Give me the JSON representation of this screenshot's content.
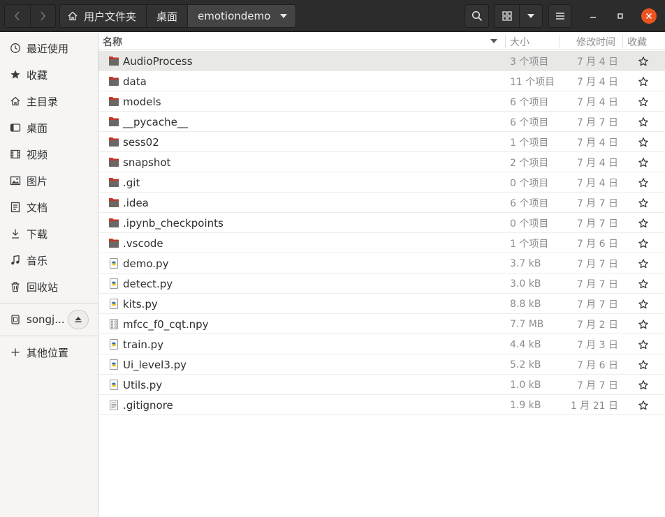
{
  "breadcrumb": {
    "home_label": "用户文件夹",
    "items": [
      "桌面",
      "emotiondemo"
    ]
  },
  "sidebar": {
    "items": [
      {
        "label": "最近使用",
        "icon": "clock-icon"
      },
      {
        "label": "收藏",
        "icon": "star-icon"
      },
      {
        "label": "主目录",
        "icon": "home-icon"
      },
      {
        "label": "桌面",
        "icon": "desktop-icon"
      },
      {
        "label": "视频",
        "icon": "video-icon"
      },
      {
        "label": "图片",
        "icon": "image-icon"
      },
      {
        "label": "文档",
        "icon": "document-icon"
      },
      {
        "label": "下载",
        "icon": "download-icon"
      },
      {
        "label": "音乐",
        "icon": "music-icon"
      },
      {
        "label": "回收站",
        "icon": "trash-icon"
      }
    ],
    "device": {
      "label": "songj...",
      "icon": "drive-icon"
    },
    "other_locations": {
      "label": "其他位置",
      "icon": "plus-icon"
    }
  },
  "columns": {
    "name": "名称",
    "size": "大小",
    "modified": "修改时间",
    "starred": "收藏"
  },
  "files": [
    {
      "name": "AudioProcess",
      "size": "3 个项目",
      "modified": "7 月 4 日",
      "type": "folder",
      "selected": true
    },
    {
      "name": "data",
      "size": "11 个项目",
      "modified": "7 月 4 日",
      "type": "folder"
    },
    {
      "name": "models",
      "size": "6 个项目",
      "modified": "7 月 4 日",
      "type": "folder"
    },
    {
      "name": "__pycache__",
      "size": "6 个项目",
      "modified": "7 月 7 日",
      "type": "folder"
    },
    {
      "name": "sess02",
      "size": "1 个项目",
      "modified": "7 月 4 日",
      "type": "folder"
    },
    {
      "name": "snapshot",
      "size": "2 个项目",
      "modified": "7 月 4 日",
      "type": "folder"
    },
    {
      "name": ".git",
      "size": "0 个项目",
      "modified": "7 月 4 日",
      "type": "folder"
    },
    {
      "name": ".idea",
      "size": "6 个项目",
      "modified": "7 月 7 日",
      "type": "folder"
    },
    {
      "name": ".ipynb_checkpoints",
      "size": "0 个项目",
      "modified": "7 月 7 日",
      "type": "folder"
    },
    {
      "name": ".vscode",
      "size": "1 个项目",
      "modified": "7 月 6 日",
      "type": "folder"
    },
    {
      "name": "demo.py",
      "size": "3.7 kB",
      "modified": "7 月 7 日",
      "type": "python"
    },
    {
      "name": "detect.py",
      "size": "3.0 kB",
      "modified": "7 月 7 日",
      "type": "python"
    },
    {
      "name": "kits.py",
      "size": "8.8 kB",
      "modified": "7 月 7 日",
      "type": "python"
    },
    {
      "name": "mfcc_f0_cqt.npy",
      "size": "7.7 MB",
      "modified": "7 月 2 日",
      "type": "binary"
    },
    {
      "name": "train.py",
      "size": "4.4 kB",
      "modified": "7 月 3 日",
      "type": "python"
    },
    {
      "name": "Ui_level3.py",
      "size": "5.2 kB",
      "modified": "7 月 6 日",
      "type": "python"
    },
    {
      "name": "Utils.py",
      "size": "1.0 kB",
      "modified": "7 月 7 日",
      "type": "python"
    },
    {
      "name": ".gitignore",
      "size": "1.9 kB",
      "modified": "1 月 21 日",
      "type": "text"
    }
  ],
  "colors": {
    "headerbar": "#2c2c2c",
    "close_button": "#e95420",
    "folder": "#5d5a58",
    "folder_tab": "#c0392b",
    "selected_row": "#e8e8e7"
  }
}
